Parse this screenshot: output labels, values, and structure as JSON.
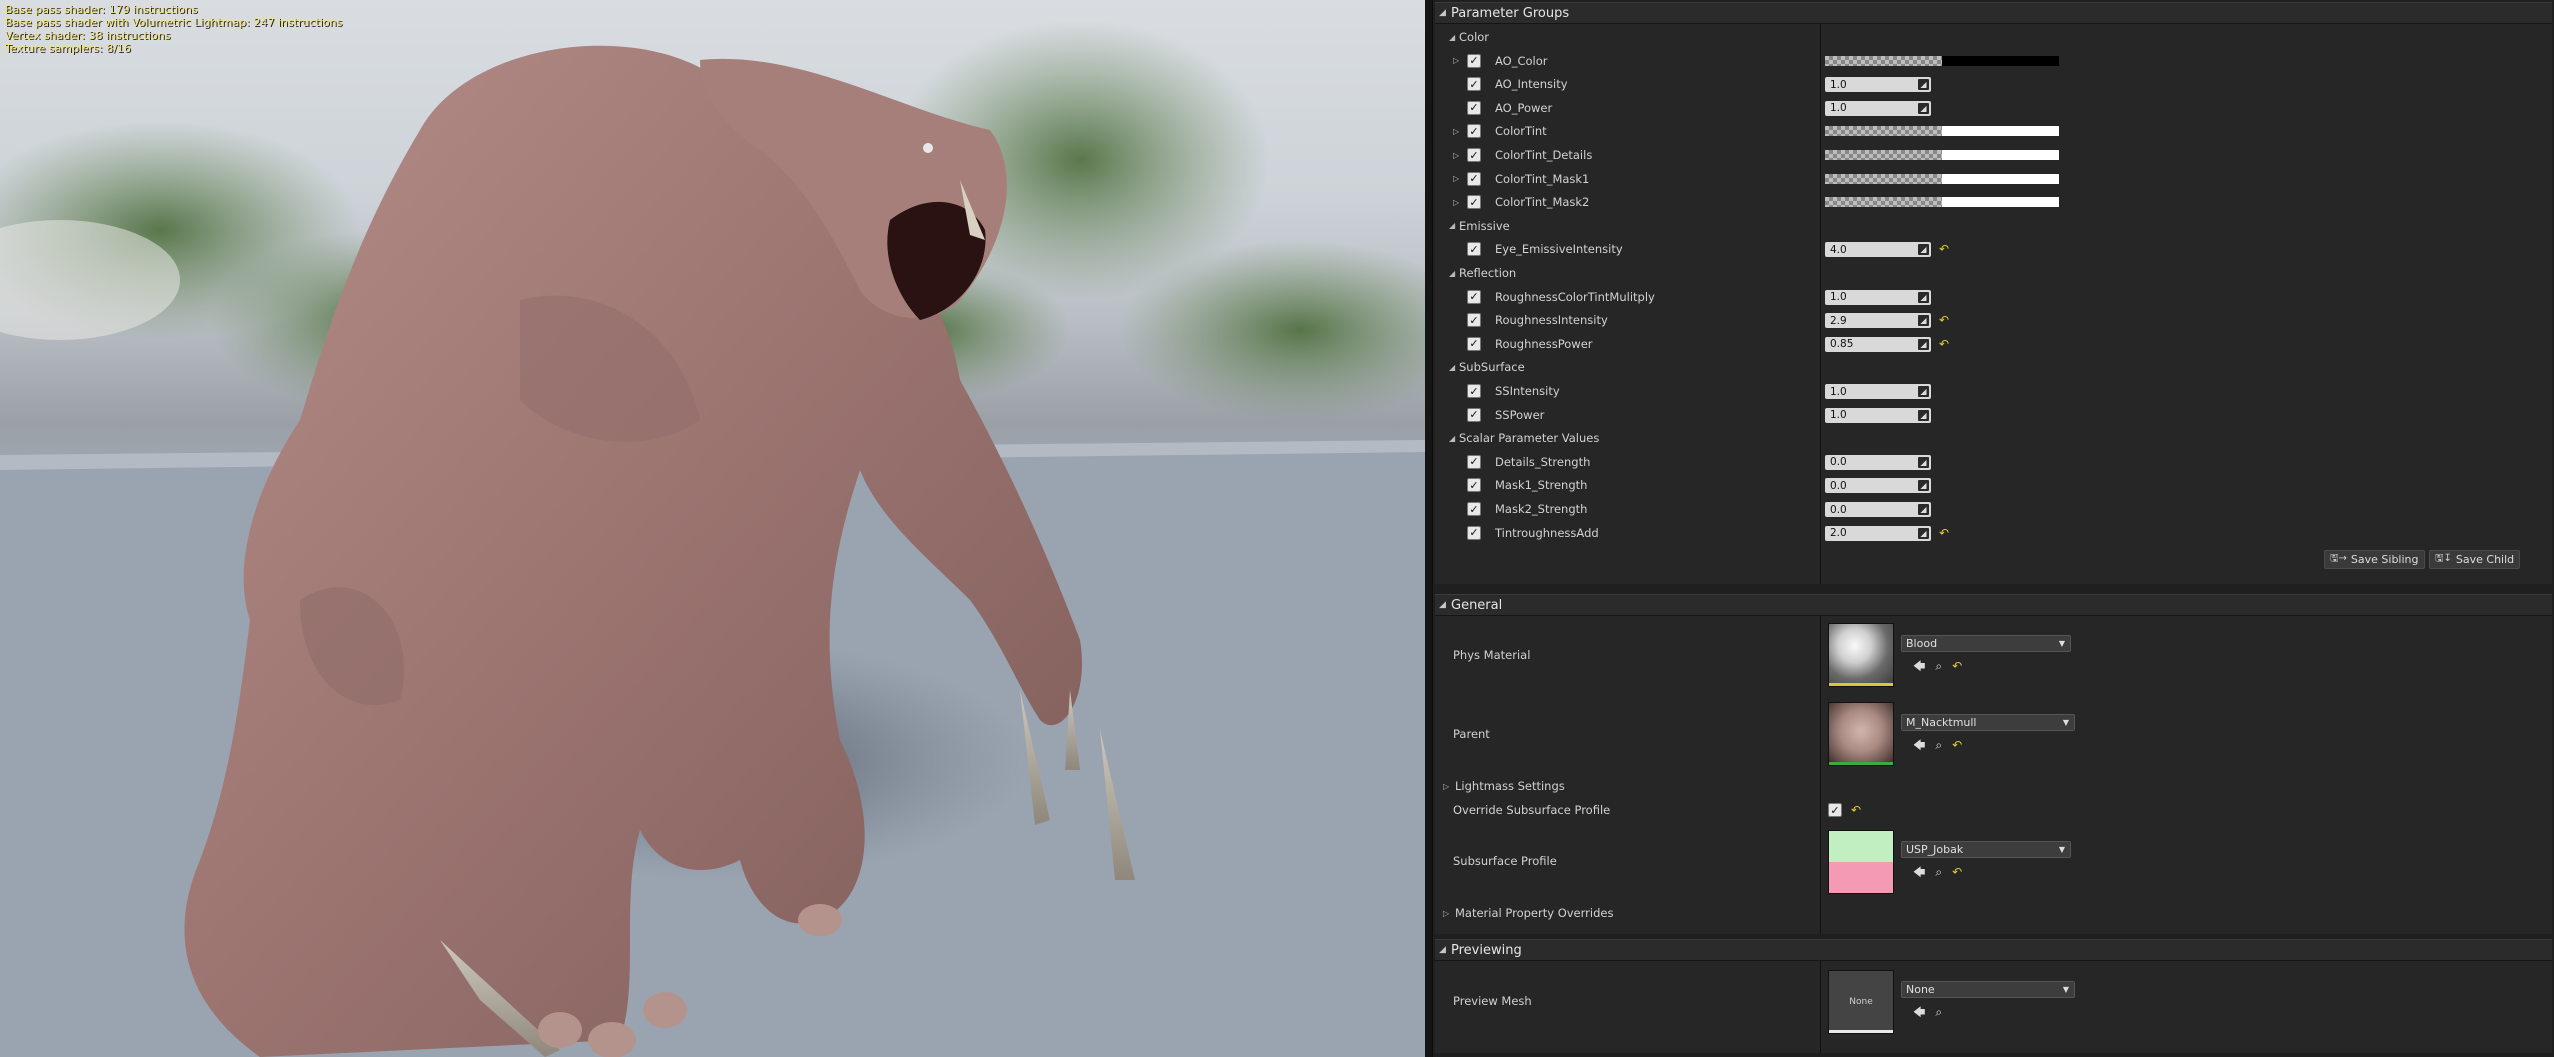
{
  "viewport": {
    "stats": [
      "Base pass shader: 179 instructions",
      "Base pass shader with Volumetric Lightmap: 247 instructions",
      "Vertex shader: 38 instructions",
      "Texture samplers: 8/16"
    ]
  },
  "parameter_groups": {
    "title": "Parameter Groups",
    "groups": [
      {
        "name": "Color",
        "params": [
          {
            "name": "AO_Color",
            "kind": "color",
            "color": "#000000",
            "expandable": true
          },
          {
            "name": "AO_Intensity",
            "kind": "scalar",
            "value": "1.0"
          },
          {
            "name": "AO_Power",
            "kind": "scalar",
            "value": "1.0"
          },
          {
            "name": "ColorTint",
            "kind": "color",
            "color": "#ffffff",
            "expandable": true
          },
          {
            "name": "ColorTint_Details",
            "kind": "color",
            "color": "#ffffff",
            "expandable": true
          },
          {
            "name": "ColorTint_Mask1",
            "kind": "color",
            "color": "#ffffff",
            "expandable": true
          },
          {
            "name": "ColorTint_Mask2",
            "kind": "color",
            "color": "#ffffff",
            "expandable": true
          }
        ]
      },
      {
        "name": "Emissive",
        "params": [
          {
            "name": "Eye_EmissiveIntensity",
            "kind": "scalar",
            "value": "4.0",
            "reset": true
          }
        ]
      },
      {
        "name": "Reflection",
        "params": [
          {
            "name": "RoughnessColorTintMulitply",
            "kind": "scalar",
            "value": "1.0"
          },
          {
            "name": "RoughnessIntensity",
            "kind": "scalar",
            "value": "2.9",
            "reset": true
          },
          {
            "name": "RoughnessPower",
            "kind": "scalar",
            "value": "0.85",
            "reset": true
          }
        ]
      },
      {
        "name": "SubSurface",
        "params": [
          {
            "name": "SSIntensity",
            "kind": "scalar",
            "value": "1.0"
          },
          {
            "name": "SSPower",
            "kind": "scalar",
            "value": "1.0"
          }
        ]
      },
      {
        "name": "Scalar Parameter Values",
        "params": [
          {
            "name": "Details_Strength",
            "kind": "scalar",
            "value": "0.0"
          },
          {
            "name": "Mask1_Strength",
            "kind": "scalar",
            "value": "0.0"
          },
          {
            "name": "Mask2_Strength",
            "kind": "scalar",
            "value": "0.0"
          },
          {
            "name": "TintroughnessAdd",
            "kind": "scalar",
            "value": "2.0",
            "reset": true
          }
        ]
      }
    ],
    "buttons": {
      "save_sibling": "Save Sibling",
      "save_child": "Save Child"
    }
  },
  "general": {
    "title": "General",
    "phys_material": {
      "label": "Phys Material",
      "value": "Blood"
    },
    "parent": {
      "label": "Parent",
      "value": "M_Nacktmull"
    },
    "lightmass": {
      "label": "Lightmass Settings"
    },
    "override_subsurface": {
      "label": "Override Subsurface Profile",
      "checked": true
    },
    "subsurface_profile": {
      "label": "Subsurface Profile",
      "value": "USP_Jobak"
    },
    "material_overrides": {
      "label": "Material Property Overrides"
    }
  },
  "previewing": {
    "title": "Previewing",
    "preview_mesh": {
      "label": "Preview Mesh",
      "value": "None",
      "thumb_text": "None"
    }
  },
  "colors": {
    "accent_yellow": "#e0c93a",
    "panel_bg": "#1f1f1f"
  }
}
